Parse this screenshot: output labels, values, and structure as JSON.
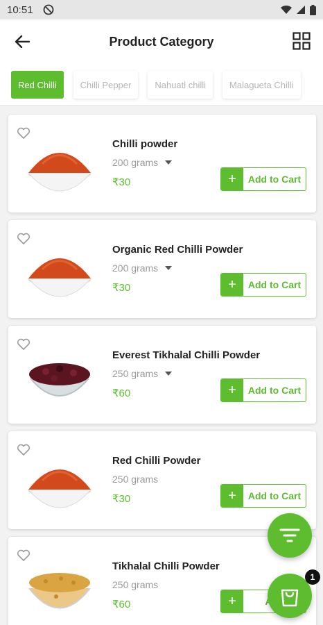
{
  "status_bar": {
    "time": "10:51"
  },
  "header": {
    "title": "Product Category"
  },
  "chips": [
    {
      "label": "Red Chilli",
      "active": true
    },
    {
      "label": "Chilli Pepper",
      "active": false
    },
    {
      "label": "Nahuatl chilli",
      "active": false
    },
    {
      "label": "Malagueta Chilli",
      "active": false
    }
  ],
  "products": [
    {
      "name": "Chilli powder",
      "weight": "200 grams",
      "price": "₹30",
      "has_dropdown": true,
      "image": "red-powder"
    },
    {
      "name": "Organic Red Chilli Powder",
      "weight": "200 grams",
      "price": "₹30",
      "has_dropdown": true,
      "image": "red-powder"
    },
    {
      "name": "Everest Tikhalal Chilli Powder",
      "weight": "250 grams",
      "price": "₹60",
      "has_dropdown": true,
      "image": "dark-beans"
    },
    {
      "name": "Red Chilli Powder",
      "weight": "250 grams",
      "price": "₹30",
      "has_dropdown": false,
      "image": "red-powder"
    },
    {
      "name": "Tikhalal Chilli Powder",
      "weight": "250 grams",
      "price": "₹60",
      "has_dropdown": false,
      "image": "yellow-seeds"
    }
  ],
  "add_to_cart_label": "Add to Cart",
  "add_to_cart_label_truncated": "Add",
  "cart_count": "1",
  "colors": {
    "accent": "#5dbd2f",
    "price": "#5dbd2f"
  },
  "icons": {
    "back": "arrow-left-icon",
    "view": "grid-view-icon",
    "favorite": "heart-outline-icon",
    "filter": "filter-icon",
    "cart": "shopping-bag-icon"
  }
}
